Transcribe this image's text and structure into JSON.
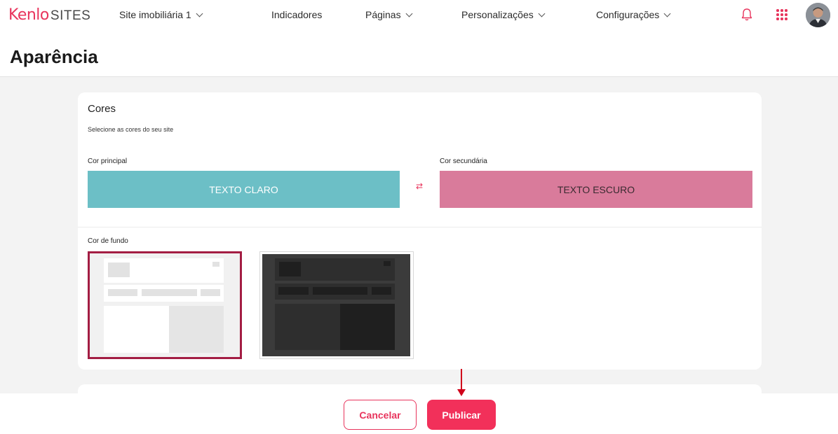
{
  "brand": {
    "name": "Kenlo",
    "product": "SITES"
  },
  "nav": {
    "site_selector": "Site imobiliária 1",
    "items": [
      {
        "label": "Indicadores",
        "dropdown": false
      },
      {
        "label": "Páginas",
        "dropdown": true
      },
      {
        "label": "Personalizações",
        "dropdown": true
      },
      {
        "label": "Configurações",
        "dropdown": true
      }
    ],
    "icons": [
      "bell-icon",
      "apps-grid-icon",
      "user-avatar"
    ]
  },
  "page": {
    "title": "Aparência"
  },
  "colors_section": {
    "title": "Cores",
    "subtitle": "Selecione as cores do seu site",
    "primary": {
      "label": "Cor principal",
      "text": "TEXTO CLARO",
      "color": "#6cbfc6",
      "text_color": "#ffffff"
    },
    "swap_icon": "⇄",
    "secondary": {
      "label": "Cor secundária",
      "text": "TEXTO ESCURO",
      "color": "#d97b9b",
      "text_color": "#3a2a30"
    },
    "background": {
      "label": "Cor de fundo",
      "options": [
        {
          "name": "light",
          "selected": true
        },
        {
          "name": "dark",
          "selected": false
        }
      ]
    }
  },
  "footer": {
    "cancel_label": "Cancelar",
    "publish_label": "Publicar"
  },
  "accent_color": "#e8345c"
}
